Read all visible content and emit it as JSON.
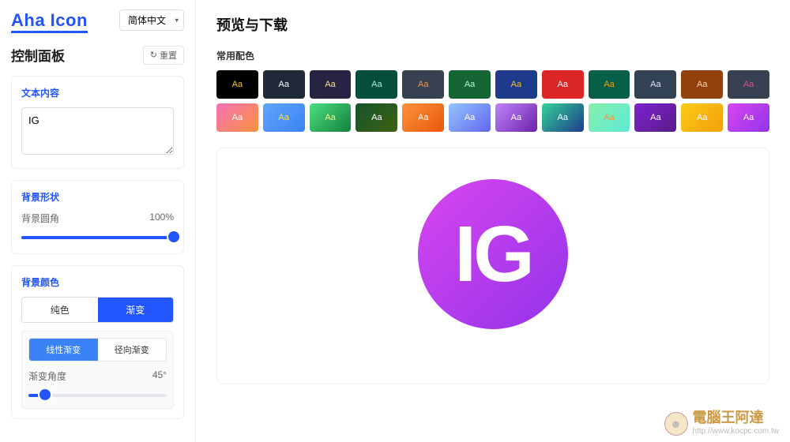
{
  "header": {
    "logo_text": "Aha Icon",
    "language_selected": "简体中文"
  },
  "sidebar": {
    "panel_title": "控制面板",
    "reset_label": "重置",
    "text_content": {
      "title": "文本内容",
      "value": "IG"
    },
    "bg_shape": {
      "title": "背景形状",
      "radius_label": "背景圆角",
      "radius_value": "100%",
      "radius_pct": 100
    },
    "bg_color": {
      "title": "背景颜色",
      "tabs": {
        "solid": "纯色",
        "gradient": "渐变"
      },
      "active_tab": "gradient",
      "grad_tabs": {
        "linear": "线性渐变",
        "radial": "径向渐变"
      },
      "active_grad": "linear",
      "angle_label": "渐变角度",
      "angle_value": "45°",
      "angle_pct": 12
    }
  },
  "main": {
    "title": "预览与下载",
    "swatch_title": "常用配色",
    "swatches_row1": [
      {
        "bg": "#000000",
        "fg": "#f5c518"
      },
      {
        "bg": "#1f2937",
        "fg": "#ffffff"
      },
      {
        "bg": "#272343",
        "fg": "#fde68a"
      },
      {
        "bg": "#064e3b",
        "fg": "#a7f3d0"
      },
      {
        "bg": "#374151",
        "fg": "#fb923c"
      },
      {
        "bg": "#166534",
        "fg": "#bbf7d0"
      },
      {
        "bg": "#1e3a8a",
        "fg": "#fbbf24"
      },
      {
        "bg": "#dc2626",
        "fg": "#ffffff"
      },
      {
        "bg": "#065f46",
        "fg": "#f59e0b"
      },
      {
        "bg": "#334155",
        "fg": "#e2e8f0"
      },
      {
        "bg": "#92400e",
        "fg": "#fed7aa"
      },
      {
        "bg": "#374151",
        "fg": "#ec4899"
      }
    ],
    "swatches_row2": [
      {
        "bg": "linear-gradient(135deg,#f472b6,#fb923c)",
        "fg": "#ffffff"
      },
      {
        "bg": "linear-gradient(135deg,#60a5fa,#3b82f6)",
        "fg": "#fde047"
      },
      {
        "bg": "linear-gradient(135deg,#4ade80,#15803d)",
        "fg": "#fef08a"
      },
      {
        "bg": "linear-gradient(135deg,#14532d,#3f6212)",
        "fg": "#ffffff"
      },
      {
        "bg": "linear-gradient(135deg,#fb923c,#ea580c)",
        "fg": "#ffffff"
      },
      {
        "bg": "linear-gradient(135deg,#93c5fd,#6366f1)",
        "fg": "#ffffff"
      },
      {
        "bg": "linear-gradient(135deg,#c084fc,#6b21a8)",
        "fg": "#ffffff"
      },
      {
        "bg": "linear-gradient(135deg,#34d399,#1e3a8a)",
        "fg": "#ffffff"
      },
      {
        "bg": "linear-gradient(135deg,#86efac,#5eead4)",
        "fg": "#fb923c"
      },
      {
        "bg": "linear-gradient(135deg,#7e22ce,#581c87)",
        "fg": "#ffffff"
      },
      {
        "bg": "linear-gradient(135deg,#facc15,#f59e0b)",
        "fg": "#ffffff"
      },
      {
        "bg": "linear-gradient(135deg,#d946ef,#9333ea)",
        "fg": "#ffffff"
      }
    ],
    "swatch_sample": "Aa",
    "preview": {
      "text": "IG",
      "bg": "linear-gradient(135deg,#d946ef,#9333ea)"
    }
  },
  "watermark": {
    "brand": "電腦王阿達",
    "url": "http://www.kocpc.com.tw"
  }
}
